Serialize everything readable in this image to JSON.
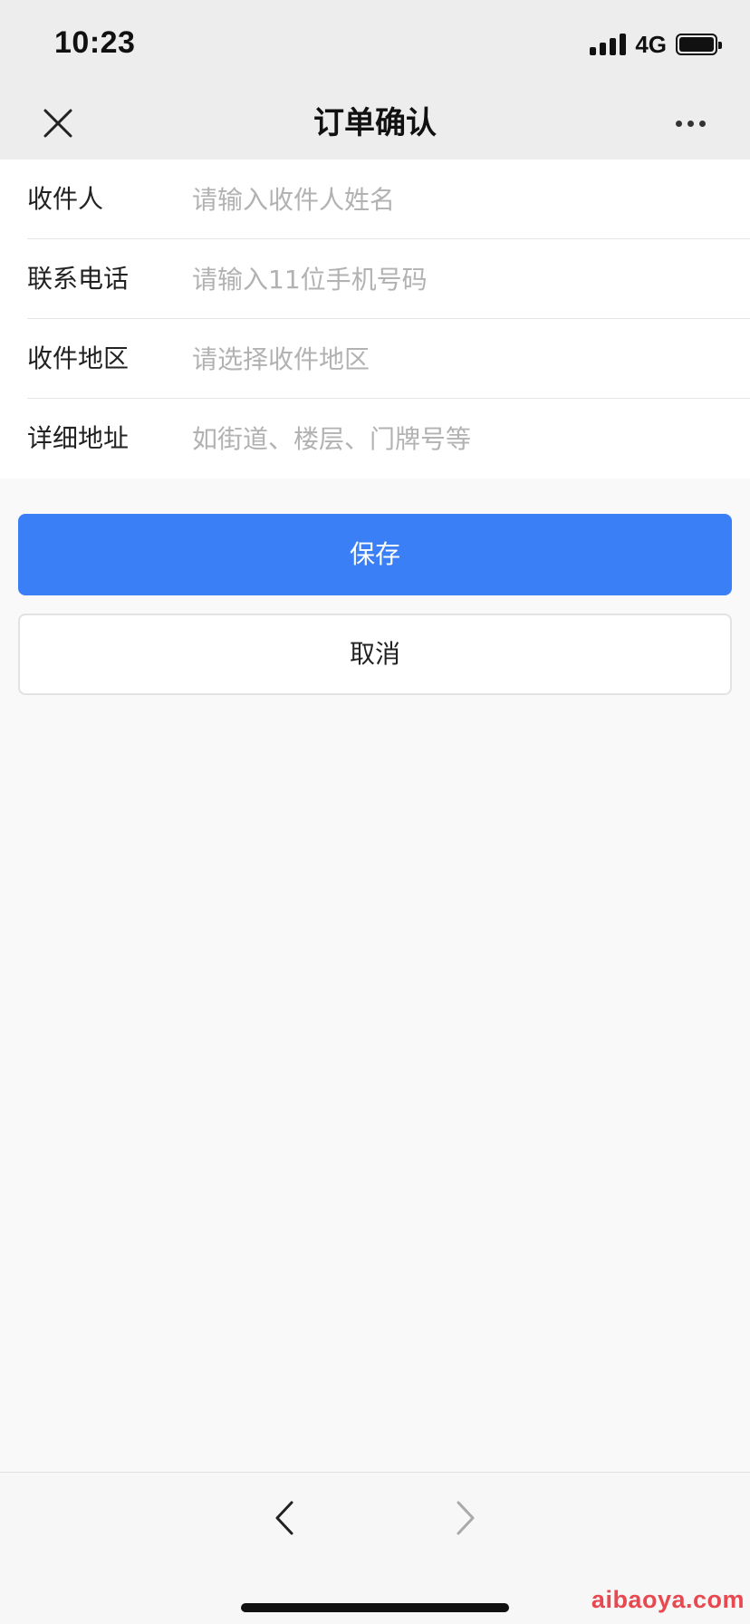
{
  "status_bar": {
    "time": "10:23",
    "network": "4G",
    "icons": [
      "signal-icon",
      "battery-icon"
    ]
  },
  "nav": {
    "title": "订单确认",
    "close_icon": "close-icon",
    "more_icon": "more-icon"
  },
  "form": {
    "fields": [
      {
        "label": "收件人",
        "value": "",
        "placeholder": "请输入收件人姓名"
      },
      {
        "label": "联系电话",
        "value": "",
        "placeholder": "请输入11位手机号码"
      },
      {
        "label": "收件地区",
        "value": "",
        "placeholder": "请选择收件地区"
      },
      {
        "label": "详细地址",
        "value": "",
        "placeholder": "如街道、楼层、门牌号等"
      }
    ]
  },
  "actions": {
    "save_label": "保存",
    "cancel_label": "取消",
    "save_color": "#3a7ff6"
  },
  "bottom_nav": {
    "back_icon": "chevron-left-icon",
    "forward_icon": "chevron-right-icon"
  },
  "watermark": "aibaoya.com"
}
